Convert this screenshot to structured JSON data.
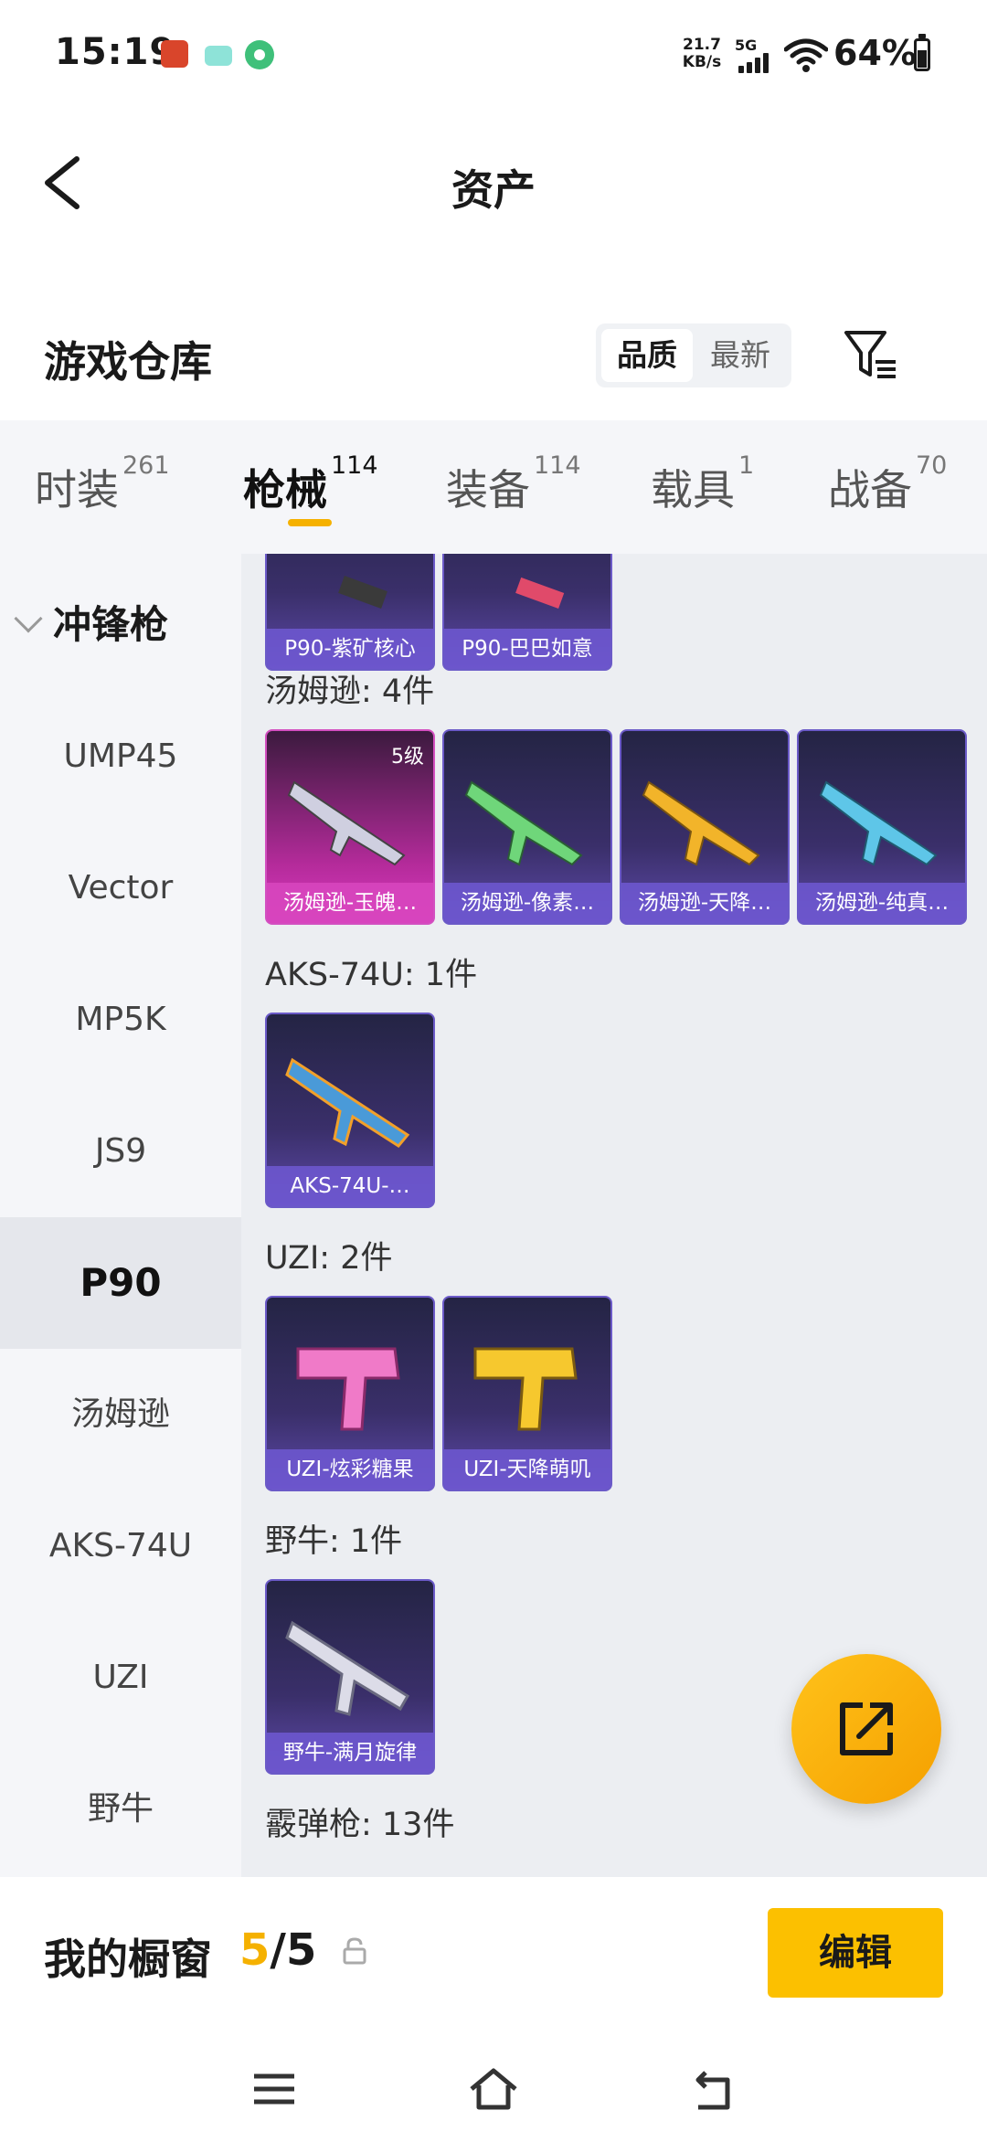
{
  "status_bar": {
    "time": "15:19",
    "net_speed": "21.7",
    "net_unit": "KB/s",
    "network": "5G",
    "battery": "64%"
  },
  "header": {
    "title": "资产"
  },
  "warehouse": {
    "title": "游戏仓库",
    "sort_quality": "品质",
    "sort_newest": "最新"
  },
  "tabs": [
    {
      "label": "时装",
      "count": "261"
    },
    {
      "label": "枪械",
      "count": "114"
    },
    {
      "label": "装备",
      "count": "114"
    },
    {
      "label": "载具",
      "count": "1"
    },
    {
      "label": "战备",
      "count": "70"
    }
  ],
  "sidebar": {
    "group": "冲锋枪",
    "items": [
      "UMP45",
      "Vector",
      "MP5K",
      "JS9",
      "P90",
      "汤姆逊",
      "AKS-74U",
      "UZI",
      "野牛"
    ]
  },
  "content": {
    "p90_cards": [
      "P90-紫矿核心",
      "P90-巴巴如意"
    ],
    "groups": [
      {
        "title": "汤姆逊: 4件",
        "items": [
          "汤姆逊-玉魄…",
          "汤姆逊-像素…",
          "汤姆逊-天降…",
          "汤姆逊-纯真…"
        ],
        "badge": "5级"
      },
      {
        "title": "AKS-74U: 1件",
        "items": [
          "AKS-74U-…"
        ]
      },
      {
        "title": "UZI: 2件",
        "items": [
          "UZI-炫彩糖果",
          "UZI-天降萌叽"
        ]
      },
      {
        "title": "野牛: 1件",
        "items": [
          "野牛-满月旋律"
        ]
      },
      {
        "title": "霰弹枪: 13件"
      }
    ]
  },
  "showcase": {
    "title": "我的橱窗",
    "count_current": "5",
    "count_sep": "/",
    "count_total": "5",
    "edit_label": "编辑"
  },
  "colors": {
    "accent": "#fcc000",
    "card_purple": "#3a2f6a",
    "card_pink": "#b52b9b"
  },
  "icons": {
    "back": "back-arrow-icon",
    "filter": "filter-icon",
    "share": "share-icon",
    "lock": "lock-icon",
    "nav_menu": "menu-icon",
    "nav_home": "home-icon",
    "nav_back": "back-icon"
  }
}
